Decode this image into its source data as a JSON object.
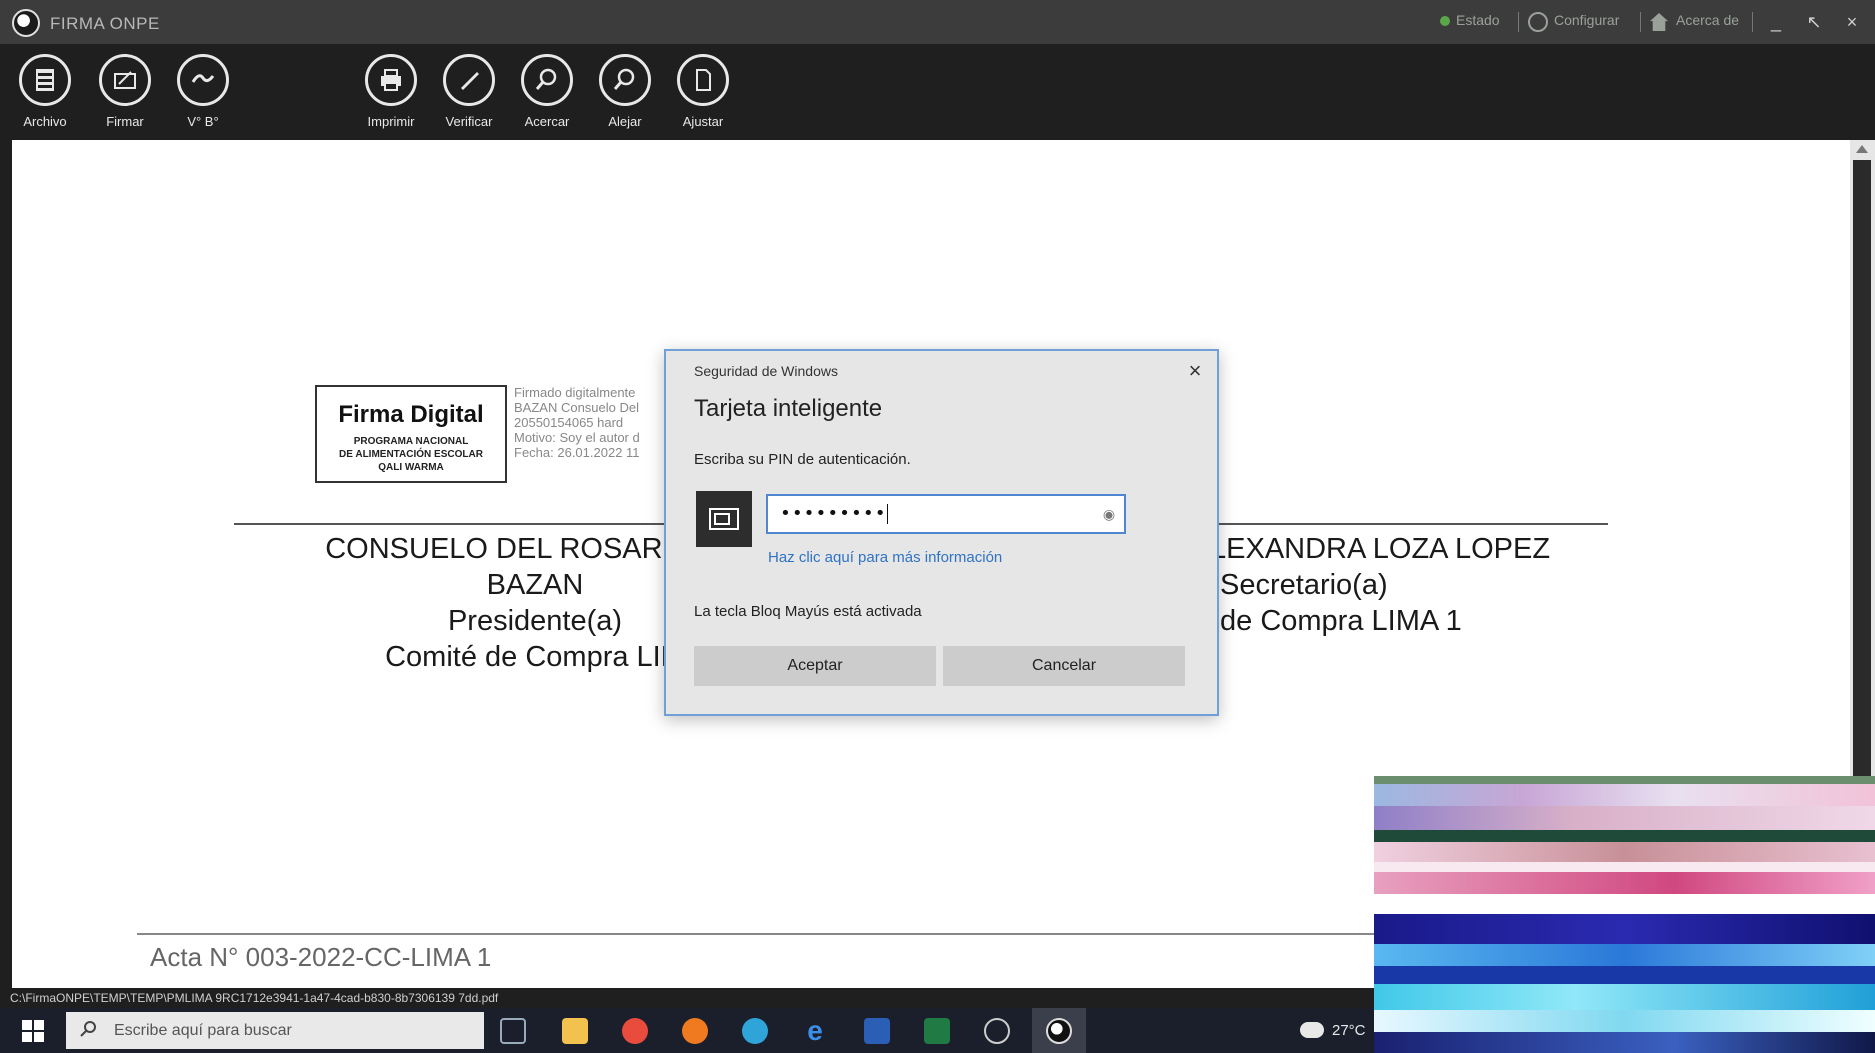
{
  "window": {
    "title": "FIRMA ONPE",
    "status_label": "Estado",
    "config_label": "Configurar",
    "about_label": "Acerca de",
    "minimize": "_",
    "restore": "↖",
    "close": "×"
  },
  "toolbar": {
    "items": [
      {
        "label": "Archivo",
        "icon": "file-cabinet-icon"
      },
      {
        "label": "Firmar",
        "icon": "sign-document-icon"
      },
      {
        "label": "V° B°",
        "icon": "approval-icon"
      },
      {
        "label": "Imprimir",
        "icon": "print-icon"
      },
      {
        "label": "Verificar",
        "icon": "verify-pen-icon"
      },
      {
        "label": "Acercar",
        "icon": "zoom-in-icon"
      },
      {
        "label": "Alejar",
        "icon": "zoom-out-icon"
      },
      {
        "label": "Ajustar",
        "icon": "fit-page-icon"
      }
    ]
  },
  "document": {
    "stamp_title": "Firma Digital",
    "stamp_line1": "PROGRAMA NACIONAL",
    "stamp_line2": "DE ALIMENTACIÓN ESCOLAR",
    "stamp_line3": "QALI WARMA",
    "stamp_details": "Firmado digitalmente\nBAZAN Consuelo Del\n20550154065 hard\nMotivo: Soy el autor d\nFecha: 26.01.2022 11",
    "left_signer": {
      "name_line1": "CONSUELO DEL ROSARIO GU",
      "name_line2": "BAZAN",
      "role": "Presidente(a)",
      "committee": "Comité de Compra LIM"
    },
    "right_signer": {
      "name_line1": "LEXANDRA LOZA LOPEZ",
      "role": "Secretario(a)",
      "committee": "de Compra LIMA 1"
    },
    "footer": "Acta N° 003-2022-CC-LIMA 1"
  },
  "dialog": {
    "caption": "Seguridad de Windows",
    "title": "Tarjeta inteligente",
    "instruction": "Escriba su PIN de autenticación.",
    "pin_value": "•••••••••",
    "more_info_link": "Haz clic aquí para más información",
    "caps_lock_warning": "La tecla Bloq Mayús está activada",
    "ok_label": "Aceptar",
    "cancel_label": "Cancelar",
    "close": "×"
  },
  "path": "C:\\FirmaONPE\\TEMP\\TEMP\\PMLIMA 9RC1712e3941-1a47-4cad-b830-8b7306139 7dd.pdf",
  "taskbar": {
    "search_placeholder": "Escribe aquí para buscar",
    "weather": "27°C"
  },
  "colors": {
    "titlebar": "#3c3c3c",
    "toolbar": "#1f1f1f",
    "dialog_border": "#6fa1d8",
    "link": "#2e73c6"
  }
}
